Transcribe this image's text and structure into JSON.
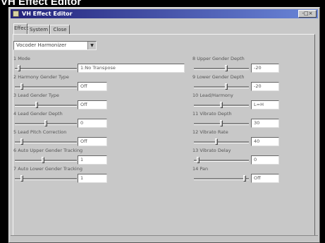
{
  "caption": "VH Effect Editor",
  "window": {
    "title": "VH Effect Editor",
    "controls_label": "-□×"
  },
  "tabs": [
    {
      "label": "Effect",
      "active": true
    },
    {
      "label": "System",
      "active": false
    },
    {
      "label": "Close",
      "active": false
    }
  ],
  "effect_select": {
    "value": "Vocoder Harmonizer",
    "arrow": "▼"
  },
  "params_left": [
    {
      "label": "1 Mode",
      "value": "1:No Transpose",
      "level": 0.05
    },
    {
      "label": "2 Harmony Gender Type",
      "value": "Off",
      "level": 0.1
    },
    {
      "label": "3 Lead Gender Type",
      "value": "Off",
      "level": 0.35
    },
    {
      "label": "4 Lead Gender Depth",
      "value": "0",
      "level": 0.5
    },
    {
      "label": "5 Lead Pitch Correction",
      "value": "Off",
      "level": 0.1
    },
    {
      "label": "6 Auto Upper Gender Tracking",
      "value": "1",
      "level": 0.45
    },
    {
      "label": "7 Auto Lower Gender Tracking",
      "value": "1",
      "level": 0.1
    }
  ],
  "params_right": [
    {
      "label": "8 Upper Gender Depth",
      "value": "-20",
      "level": 0.6
    },
    {
      "label": "9 Lower Gender Depth",
      "value": "-20",
      "level": 0.6
    },
    {
      "label": "10 Lead/Harmony",
      "value": "L=H",
      "level": 0.5
    },
    {
      "label": "11 Vibrato Depth",
      "value": "30",
      "level": 0.5
    },
    {
      "label": "12 Vibrato Rate",
      "value": "40",
      "level": 0.4
    },
    {
      "label": "13 Vibrato Delay",
      "value": "0",
      "level": 0.05
    },
    {
      "label": "14 Pan",
      "value": "Off",
      "level": 0.95
    }
  ]
}
